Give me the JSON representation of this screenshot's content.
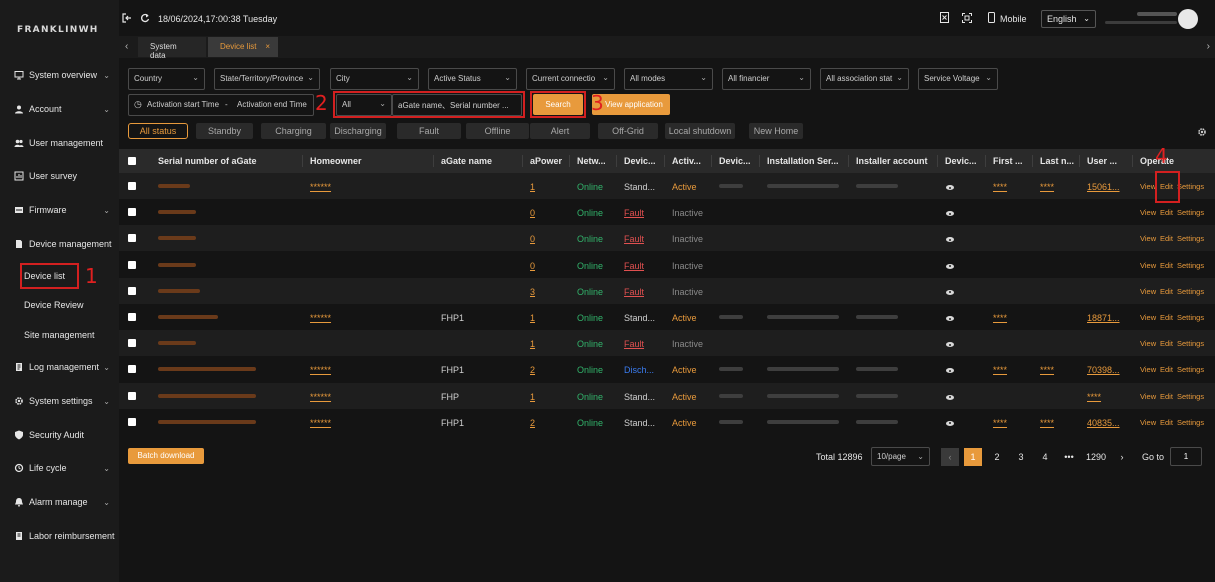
{
  "brand": {
    "logo": "FRANKLINWH"
  },
  "sidebar": {
    "items": [
      {
        "label": "System overview",
        "icon": "monitor-icon",
        "chevron": true
      },
      {
        "label": "Account",
        "icon": "account-icon",
        "chevron": true
      },
      {
        "label": "User management",
        "icon": "users-icon",
        "chevron": false
      },
      {
        "label": "User survey",
        "icon": "survey-icon",
        "chevron": false
      },
      {
        "label": "Firmware",
        "icon": "firmware-icon",
        "chevron": true
      },
      {
        "label": "Device management",
        "icon": "device-icon",
        "chevron": false
      },
      {
        "label": "Log management",
        "icon": "log-icon",
        "chevron": true
      },
      {
        "label": "System settings",
        "icon": "settings-icon",
        "chevron": true
      },
      {
        "label": "Security Audit",
        "icon": "shield-icon",
        "chevron": false
      },
      {
        "label": "Life cycle",
        "icon": "cycle-icon",
        "chevron": true
      },
      {
        "label": "Alarm manage",
        "icon": "alarm-icon",
        "chevron": true
      },
      {
        "label": "Labor reimbursement",
        "icon": "reimburse-icon",
        "chevron": false
      }
    ],
    "sub_items": [
      "Device list",
      "Device Review",
      "Site management"
    ]
  },
  "topbar": {
    "datetime": "18/06/2024,17:00:38 Tuesday",
    "mobile_label": "Mobile",
    "language": "English"
  },
  "tabs": [
    {
      "label": "System data",
      "active": false
    },
    {
      "label": "Device list",
      "active": true,
      "close": "×"
    }
  ],
  "filters": {
    "country": "Country",
    "state": "State/Territory/Province",
    "city": "City",
    "active_status": "Active Status",
    "current_connection": "Current connectio",
    "all_modes": "All modes",
    "all_financier": "All financier",
    "all_association": "All association stat",
    "service_voltage": "Service Voltage",
    "activation_start": "Activation start Time",
    "range_sep": "-",
    "activation_end": "Activation end Time",
    "search_type": "All",
    "search_placeholder": "aGate name、Serial number ...",
    "search_button": "Search",
    "view_application": "View application"
  },
  "status_chips": [
    "All status",
    "Standby",
    "Charging",
    "Discharging",
    "Fault",
    "Offline",
    "Alert",
    "Off-Grid",
    "Local shutdown",
    "New Home"
  ],
  "table": {
    "headers": [
      "Serial number of aGate",
      "Homeowner",
      "aGate name",
      "aPower",
      "Netw...",
      "Devic...",
      "Activ...",
      "Devic...",
      "Installation Ser...",
      "Installer account",
      "Devic...",
      "First ...",
      "Last n...",
      "User ...",
      "Operate"
    ],
    "rows": [
      {
        "homeowner": "******",
        "agate_name": "",
        "apower": "1",
        "network": "Online",
        "device_status": "Stand...",
        "status_class": "normal",
        "active": "Active",
        "first": "****",
        "last": "****",
        "user": "15061...",
        "installer": true
      },
      {
        "homeowner": "",
        "agate_name": "",
        "apower": "0",
        "network": "Online",
        "device_status": "Fault",
        "status_class": "fault",
        "active": "Inactive",
        "first": "",
        "last": "",
        "user": "",
        "installer": false
      },
      {
        "homeowner": "",
        "agate_name": "",
        "apower": "0",
        "network": "Online",
        "device_status": "Fault",
        "status_class": "fault",
        "active": "Inactive",
        "first": "",
        "last": "",
        "user": "",
        "installer": false
      },
      {
        "homeowner": "",
        "agate_name": "",
        "apower": "0",
        "network": "Online",
        "device_status": "Fault",
        "status_class": "fault",
        "active": "Inactive",
        "first": "",
        "last": "",
        "user": "",
        "installer": false
      },
      {
        "homeowner": "",
        "agate_name": "",
        "apower": "3",
        "network": "Online",
        "device_status": "Fault",
        "status_class": "fault",
        "active": "Inactive",
        "first": "",
        "last": "",
        "user": "",
        "installer": false
      },
      {
        "homeowner": "******",
        "agate_name": "FHP1",
        "apower": "1",
        "network": "Online",
        "device_status": "Stand...",
        "status_class": "normal",
        "active": "Active",
        "first": "****",
        "last": "",
        "user": "18871...",
        "installer": true
      },
      {
        "homeowner": "",
        "agate_name": "",
        "apower": "1",
        "network": "Online",
        "device_status": "Fault",
        "status_class": "fault",
        "active": "Inactive",
        "first": "",
        "last": "",
        "user": "",
        "installer": false
      },
      {
        "homeowner": "******",
        "agate_name": "FHP1",
        "apower": "2",
        "network": "Online",
        "device_status": "Disch...",
        "status_class": "disch",
        "active": "Active",
        "first": "****",
        "last": "****",
        "user": "70398...",
        "installer": true
      },
      {
        "homeowner": "******",
        "agate_name": "FHP",
        "apower": "1",
        "network": "Online",
        "device_status": "Stand...",
        "status_class": "normal",
        "active": "Active",
        "first": "",
        "last": "",
        "user": "****",
        "installer": true
      },
      {
        "homeowner": "******",
        "agate_name": "FHP1",
        "apower": "2",
        "network": "Online",
        "device_status": "Stand...",
        "status_class": "normal",
        "active": "Active",
        "first": "****",
        "last": "****",
        "user": "40835...",
        "installer": true
      }
    ],
    "operate": {
      "view": "View",
      "edit": "Edit",
      "settings": "Settings"
    }
  },
  "footer": {
    "batch_download": "Batch download",
    "total": "Total 12896",
    "page_size": "10/page",
    "pages": [
      "1",
      "2",
      "3",
      "4",
      "•••",
      "1290"
    ],
    "prev": "‹",
    "next": "›",
    "goto_label": "Go to",
    "goto_value": "1"
  },
  "annotations": [
    "1",
    "2",
    "3",
    "4"
  ],
  "colors": {
    "accent": "#e89a3c",
    "online": "#32b36b",
    "fault": "#e05050",
    "discharging": "#3a7cf0",
    "marker": "#d32020"
  }
}
